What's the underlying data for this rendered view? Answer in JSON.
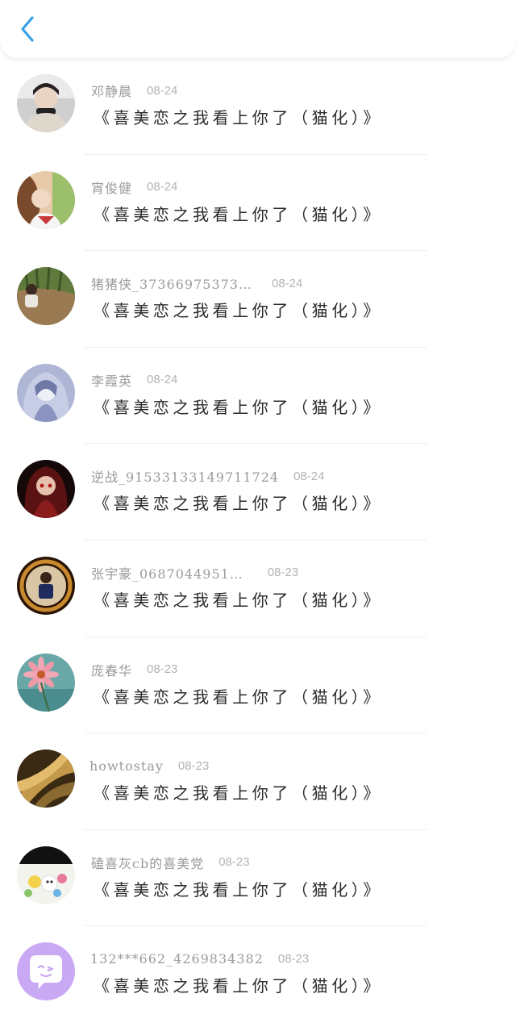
{
  "header": {
    "back_icon": "chevron-left-icon",
    "accent_color": "#3aa0e8"
  },
  "items": [
    {
      "name": "邓静晨",
      "date": "08-24",
      "title": "《喜美恋之我看上你了（猫化）》",
      "avatar": "photo-girl-scarf"
    },
    {
      "name": "宵俊健",
      "date": "08-24",
      "title": "《喜美恋之我看上你了（猫化）》",
      "avatar": "photo-girl-sailor"
    },
    {
      "name": "猪猪侠_37366975373…",
      "date": "08-24",
      "title": "《喜美恋之我看上你了（猫化）》",
      "avatar": "photo-child-field"
    },
    {
      "name": "李霞英",
      "date": "08-24",
      "title": "《喜美恋之我看上你了（猫化）》",
      "avatar": "anime-girl-blue"
    },
    {
      "name": "逆战_91533133149711724",
      "date": "08-24",
      "title": "《喜美恋之我看上你了（猫化）》",
      "avatar": "anime-girl-dark"
    },
    {
      "name": "张宇豪_0687044951…",
      "date": "08-23",
      "title": "《喜美恋之我看上你了（猫化）》",
      "avatar": "photo-boy-frame"
    },
    {
      "name": "庞春华",
      "date": "08-23",
      "title": "《喜美恋之我看上你了（猫化）》",
      "avatar": "flower-teal"
    },
    {
      "name": "howtostay",
      "date": "08-23",
      "title": "《喜美恋之我看上你了（猫化）》",
      "avatar": "golden-hair"
    },
    {
      "name": "磕喜灰cb的喜美党",
      "date": "08-23",
      "title": "《喜美恋之我看上你了（猫化）》",
      "avatar": "cartoon-sheep"
    },
    {
      "name": "132***662_4269834382",
      "date": "08-23",
      "title": "《喜美恋之我看上你了（猫化）》",
      "avatar": "default-chat-purple"
    }
  ]
}
